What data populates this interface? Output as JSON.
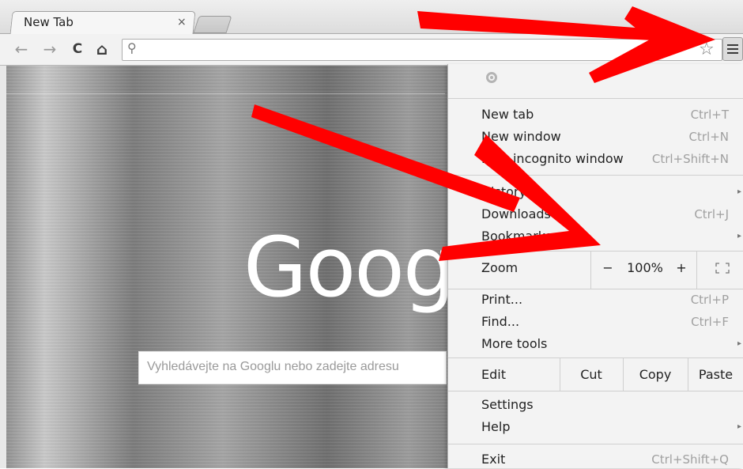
{
  "browser": {
    "tab": {
      "title": "New Tab",
      "close_glyph": "×"
    },
    "toolbar": {
      "back_icon": "←",
      "forward_icon": "→",
      "reload_icon": "C",
      "home_icon": "⌂",
      "search_glyph": "⚲",
      "star_glyph": "☆",
      "omnibox_value": ""
    }
  },
  "page": {
    "logo_text": "Goog",
    "search_placeholder": "Vyhledávejte na Googlu nebo zadejte adresu"
  },
  "menu": {
    "items_top": [
      {
        "label": "New tab",
        "shortcut": "Ctrl+T"
      },
      {
        "label": "New window",
        "shortcut": "Ctrl+N"
      },
      {
        "label": "New incognito window",
        "shortcut": "Ctrl+Shift+N"
      }
    ],
    "items_history": [
      {
        "label": "History",
        "shortcut": ""
      },
      {
        "label": "Downloads",
        "shortcut": "Ctrl+J"
      },
      {
        "label": "Bookmarks",
        "shortcut": ""
      }
    ],
    "zoom": {
      "label": "Zoom",
      "minus": "−",
      "value": "100%",
      "plus": "+"
    },
    "items_tools": [
      {
        "label": "Print...",
        "shortcut": "Ctrl+P"
      },
      {
        "label": "Find...",
        "shortcut": "Ctrl+F"
      },
      {
        "label": "More tools",
        "shortcut": ""
      }
    ],
    "edit": {
      "label": "Edit",
      "cut": "Cut",
      "copy": "Copy",
      "paste": "Paste"
    },
    "items_settings": [
      {
        "label": "Settings"
      },
      {
        "label": "Help"
      }
    ],
    "exit": {
      "label": "Exit",
      "shortcut": "Ctrl+Shift+Q"
    },
    "submenu_glyph": "▸"
  },
  "colors": {
    "arrow": "#ff0000",
    "menu_bg": "#f3f3f3"
  }
}
